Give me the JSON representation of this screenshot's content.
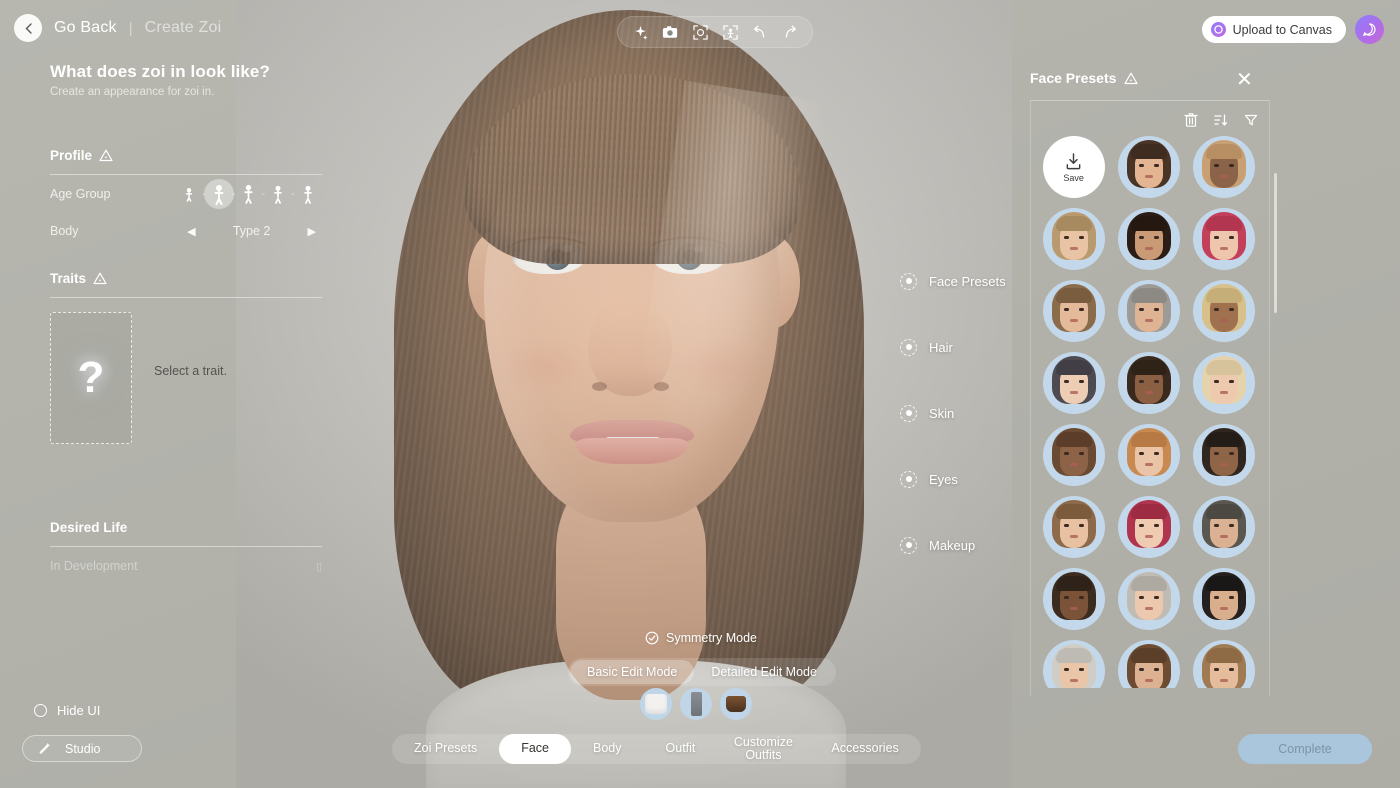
{
  "header": {
    "back_label": "Go Back",
    "separator": "|",
    "page_name": "Create Zoi",
    "title": "What does zoi in look like?",
    "subtitle": "Create an appearance for zoi in."
  },
  "top_toolbar": {
    "icons": [
      {
        "name": "magic-wand-icon",
        "glyph": "✦"
      },
      {
        "name": "camera-icon",
        "glyph": "▣"
      },
      {
        "name": "face-focus-icon",
        "glyph": "⊡"
      },
      {
        "name": "body-focus-icon",
        "glyph": "⊞"
      },
      {
        "name": "undo-icon",
        "glyph": "↰"
      },
      {
        "name": "redo-icon",
        "glyph": "↱"
      }
    ]
  },
  "top_right": {
    "upload_label": "Upload to Canvas",
    "brand_letter": "C",
    "brand_color": "#a078e8"
  },
  "profile": {
    "section_title": "Profile",
    "age_group_label": "Age Group",
    "age_group_selected_index": 1,
    "age_group_count": 5,
    "body_label": "Body",
    "body_value": "Type 2",
    "prev_arrow": "◀",
    "next_arrow": "▶"
  },
  "traits": {
    "section_title": "Traits",
    "placeholder_glyph": "?",
    "hint": "Select a trait."
  },
  "desired_life": {
    "section_title": "Desired Life",
    "status": "In Development",
    "lock_glyph": "▯"
  },
  "stage_nav": {
    "items": [
      {
        "label": "Face Presets",
        "active": true
      },
      {
        "label": "Hair",
        "active": false
      },
      {
        "label": "Skin",
        "active": false
      },
      {
        "label": "Eyes",
        "active": false
      },
      {
        "label": "Makeup",
        "active": false
      }
    ]
  },
  "stage_controls": {
    "symmetry_label": "Symmetry Mode",
    "edit_modes": [
      {
        "label": "Basic Edit Mode",
        "active": true
      },
      {
        "label": "Detailed Edit Mode",
        "active": false
      }
    ],
    "outfit_items": [
      {
        "name": "shirt-thumbnail"
      },
      {
        "name": "pants-thumbnail"
      },
      {
        "name": "shoes-thumbnail"
      }
    ]
  },
  "bottom_left": {
    "hide_ui_label": "Hide UI",
    "studio_label": "Studio"
  },
  "bottom_tabs": {
    "items": [
      {
        "label": "Zoi Presets",
        "active": false
      },
      {
        "label": "Face",
        "active": true
      },
      {
        "label": "Body",
        "active": false
      },
      {
        "label": "Outfit",
        "active": false
      },
      {
        "label": "Customize Outfits",
        "active": false,
        "two_line": true
      },
      {
        "label": "Accessories",
        "active": false
      }
    ],
    "complete_label": "Complete",
    "complete_color": "#a9c6dd"
  },
  "presets_panel": {
    "title": "Face Presets",
    "close_glyph": "✕",
    "tools": [
      {
        "name": "trash-icon",
        "glyph": "🗑"
      },
      {
        "name": "sort-icon",
        "glyph": "⇅"
      },
      {
        "name": "filter-icon",
        "glyph": "▽"
      }
    ],
    "save_label": "Save",
    "avatars": [
      {
        "hair": "#4a3426",
        "skin": "#e3b593",
        "fringe": "#3f2c20"
      },
      {
        "hair": "#c9a074",
        "skin": "#8b6348",
        "fringe": "#b88f63"
      },
      {
        "hair": "#b99a6e",
        "skin": "#e8c3a4",
        "fringe": "#a88a60"
      },
      {
        "hair": "#2b1d15",
        "skin": "#c99a75",
        "fringe": "#241811"
      },
      {
        "hair": "#c4405a",
        "skin": "#eec6ae",
        "fringe": "#b23650"
      },
      {
        "hair": "#8a6b4a",
        "skin": "#e4bb9a",
        "fringe": "#7a5c3e"
      },
      {
        "hair": "#9e9a96",
        "skin": "#dfb494",
        "fringe": "#8d8985"
      },
      {
        "hair": "#d8c089",
        "skin": "#a0714f",
        "fringe": "#c6ae78"
      },
      {
        "hair": "#4d4a52",
        "skin": "#edcdb4",
        "fringe": "#413e46"
      },
      {
        "hair": "#3a2a1d",
        "skin": "#8a5f42",
        "fringe": "#2f2217"
      },
      {
        "hair": "#e5d3ad",
        "skin": "#edc9ae",
        "fringe": "#d6c29b"
      },
      {
        "hair": "#6b4a33",
        "skin": "#8d6348",
        "fringe": "#5b3d29"
      },
      {
        "hair": "#c98a52",
        "skin": "#e9c4a6",
        "fringe": "#b87a45"
      },
      {
        "hair": "#2f2620",
        "skin": "#8f6547",
        "fringe": "#241c17"
      },
      {
        "hair": "#8c6a4a",
        "skin": "#e7c1a1",
        "fringe": "#7c5b3d"
      },
      {
        "hair": "#b0344e",
        "skin": "#efcbb2",
        "fringe": "#9d2b42"
      },
      {
        "hair": "#5a5650",
        "skin": "#dbb194",
        "fringe": "#4c4842"
      },
      {
        "hair": "#3c2c20",
        "skin": "#7b5338",
        "fringe": "#2f2218"
      },
      {
        "hair": "#c0bcb4",
        "skin": "#ecc9ae",
        "fringe": "#aeaaa2"
      },
      {
        "hair": "#23201e",
        "skin": "#d9ae8d",
        "fringe": "#1a1816"
      },
      {
        "hair": "#d0cdc6",
        "skin": "#eac6a8",
        "fringe": "#bebbb4"
      },
      {
        "hair": "#6d4c32",
        "skin": "#dcb292",
        "fringe": "#5c3f28"
      },
      {
        "hair": "#a07a52",
        "skin": "#e5bd9d",
        "fringe": "#8f6b45"
      }
    ]
  }
}
